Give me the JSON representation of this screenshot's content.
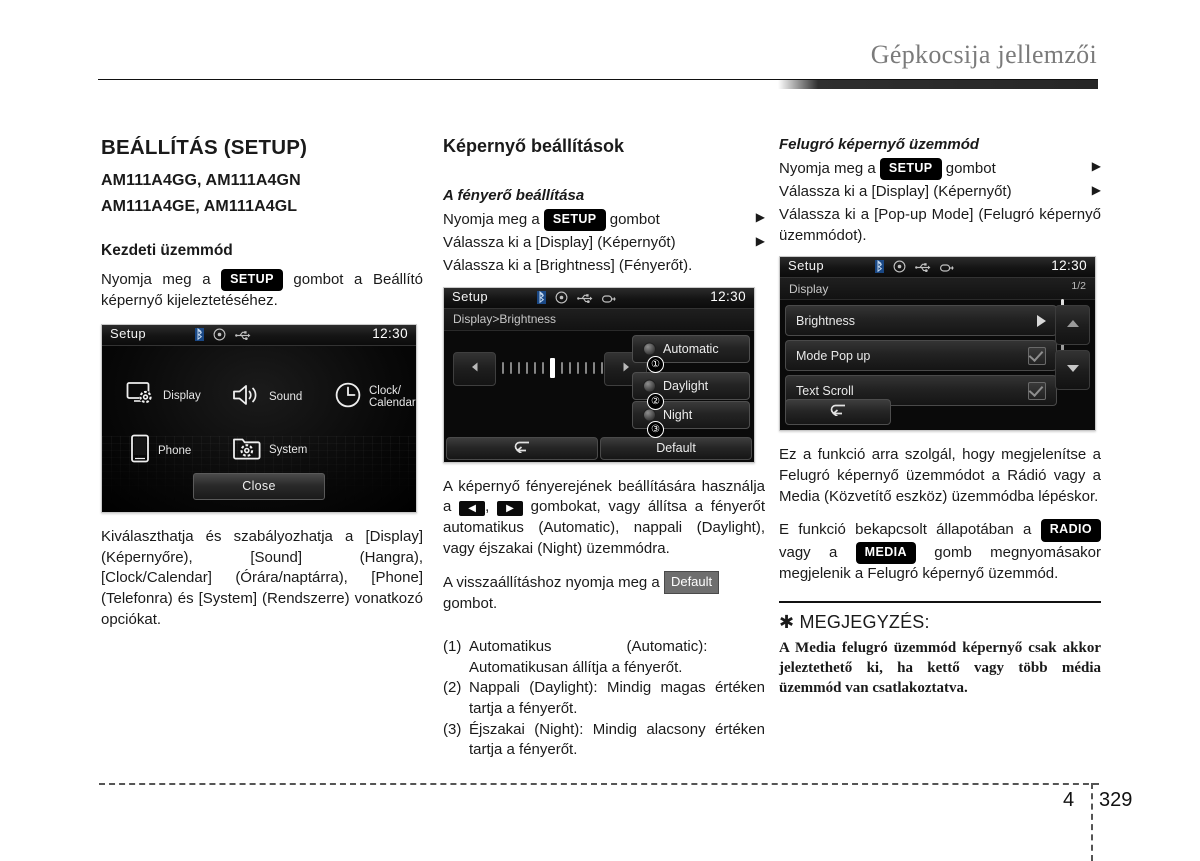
{
  "header": {
    "title": "Gépkocsija jellemzői"
  },
  "footer": {
    "chapter": "4",
    "page": "329"
  },
  "col1": {
    "section_title": "BEÁLLÍTÁS (SETUP)",
    "models_line1": "AM111A4GG, AM111A4GN",
    "models_line2": "AM111A4GE, AM111A4GL",
    "block_title": "Kezdeti üzemmód",
    "instr_pre": "Nyomja meg a",
    "instr_badge": "SETUP",
    "instr_post": "gombot a Beállító képernyő kijeleztetéséhez.",
    "paragraph": "Kiválaszthatja és szabályozhatja a [Display] (Képernyőre), [Sound] (Hangra), [Clock/Calendar] (Órára/naptárra), [Phone] (Telefonra) és [System] (Rendszerre) vonatkozó opciókat.",
    "screen": {
      "title": "Setup",
      "clock": "12:30",
      "icons": [
        "bluetooth-icon",
        "disc-icon",
        "usb-icon"
      ],
      "menu_items": [
        {
          "label": "Display",
          "icon": "display-gear-icon"
        },
        {
          "label": "Sound",
          "icon": "speaker-icon"
        },
        {
          "label": "Clock/",
          "label2": "Calendar",
          "icon": "clock-icon"
        },
        {
          "label": "Phone",
          "icon": "phone-icon"
        },
        {
          "label": "System",
          "icon": "folder-gear-icon"
        }
      ],
      "close_label": "Close"
    }
  },
  "col2": {
    "col_title": "Képernyő beállítások",
    "italic_title": "A fényerő beállítása",
    "steps": [
      {
        "pre": "Nyomja meg a",
        "badge": "SETUP",
        "post": "gombot",
        "arrow": "▶"
      },
      {
        "text": "Válassza ki a [Display] (Képernyőt)",
        "arrow": "▶"
      },
      {
        "text": "Válassza ki a [Brightness] (Fényerőt)."
      }
    ],
    "screen": {
      "title": "Setup",
      "clock": "12:30",
      "breadcrumb": "Display>Brightness",
      "icons": [
        "bluetooth-icon",
        "disc-icon",
        "usb-icon",
        "aux-icon"
      ],
      "options": [
        {
          "num": "①",
          "label": "Automatic"
        },
        {
          "num": "②",
          "label": "Daylight"
        },
        {
          "num": "③",
          "label": "Night"
        }
      ],
      "back_icon": "back-arrow-icon",
      "default_label": "Default"
    },
    "para_a_pre": "A képernyő fényerejének beállítására használja a",
    "para_a_key1": "◀",
    "para_a_mid": ",",
    "para_a_key2": "▶",
    "para_a_post": "gombokat, vagy állítsa a fényerőt automatikus (Automatic), nappali (Daylight), vagy éjszakai (Night) üzemmódra.",
    "para_b_pre": "A visszaállításhoz nyomja meg a",
    "para_b_badge": "Default",
    "para_b_post": "gombot.",
    "numbered": [
      {
        "n": "(1)",
        "text": "Automatikus     (Automatic): Automatikusan állítja a fényerőt."
      },
      {
        "n": "(2)",
        "text": "Nappali (Daylight): Mindig magas értéken tartja a fényerőt."
      },
      {
        "n": "(3)",
        "text": "Éjszakai (Night): Mindig alacsony értéken tartja a fényerőt."
      }
    ]
  },
  "col3": {
    "italic_title": "Felugró képernyő üzemmód",
    "steps": [
      {
        "pre": "Nyomja meg a",
        "badge": "SETUP",
        "post": "gombot",
        "arrow": "▶"
      },
      {
        "text": "Válassza ki a [Display] (Képernyőt)",
        "arrow": "▶"
      },
      {
        "text": "Válassza ki a [Pop-up Mode] (Felugró képernyő üzemmódot)."
      }
    ],
    "screen": {
      "title": "Setup",
      "clock": "12:30",
      "breadcrumb": "Display",
      "page_indicator": "1/2",
      "icons": [
        "bluetooth-icon",
        "disc-icon",
        "usb-icon",
        "aux-icon"
      ],
      "rows": [
        {
          "label": "Brightness",
          "control": "arrow"
        },
        {
          "label": "Mode Pop up",
          "control": "check"
        },
        {
          "label": "Text Scroll",
          "control": "check"
        }
      ],
      "back_icon": "back-arrow-icon",
      "scroll_up_icon": "chevron-up-icon",
      "scroll_down_icon": "chevron-down-icon"
    },
    "para_a": "Ez a funkció arra szolgál, hogy megjelenítse a Felugró képernyő üzemmódot a Rádió vagy a Media (Közvetítő eszköz) üzemmódba lépéskor.",
    "para_b_pre": "E funkció bekapcsolt állapotában a",
    "para_b_badge1": "RADIO",
    "para_b_mid": "vagy a",
    "para_b_badge2": "MEDIA",
    "para_b_post": "gomb megnyomásakor megjelenik a Felugró képernyő üzemmód.",
    "note_head": "✱ MEGJEGYZÉS:",
    "note_body": "A Media felugró üzemmód képernyő csak akkor jeleztethető ki, ha kettő vagy több média üzemmód van csatlakoztatva."
  }
}
